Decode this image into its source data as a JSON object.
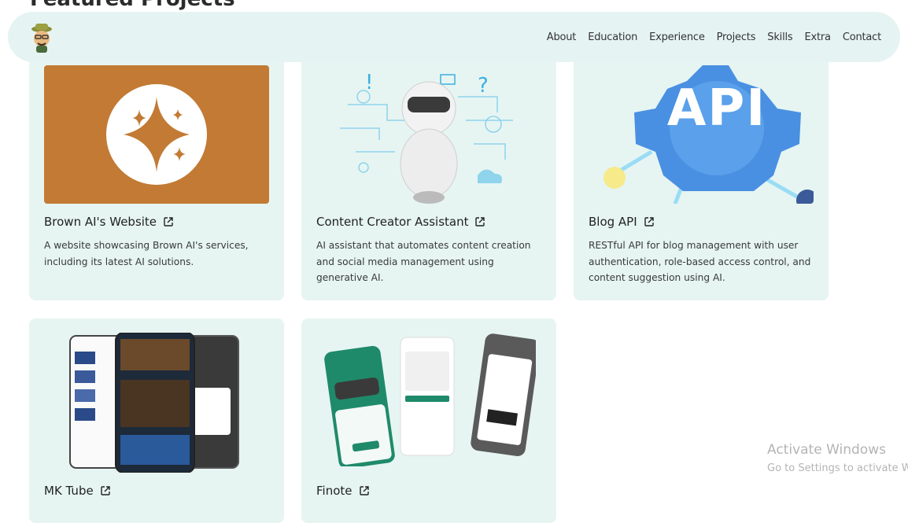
{
  "page": {
    "section_title": "Featured Projects"
  },
  "nav": {
    "items": [
      "About",
      "Education",
      "Experience",
      "Projects",
      "Skills",
      "Extra",
      "Contact"
    ]
  },
  "projects": [
    {
      "title": "Brown AI's Website",
      "description": "A website showcasing Brown AI's services, including its latest AI solutions.",
      "icon": "sparkle-logo-icon"
    },
    {
      "title": "Content Creator Assistant",
      "description": "AI assistant that automates content creation and social media management using generative AI.",
      "icon": "robot-illustration"
    },
    {
      "title": "Blog API",
      "description": "RESTful API for blog management with user authentication, role-based access control, and content suggestion using AI.",
      "icon": "api-gear-illustration",
      "thumb_label": "API"
    },
    {
      "title": "MK Tube",
      "description": "",
      "icon": "phone-screens-illustration"
    },
    {
      "title": "Finote",
      "description": "",
      "icon": "travel-app-screens-illustration"
    }
  ],
  "watermark": {
    "line1": "Activate Windows",
    "line2": "Go to Settings to activate Windows."
  },
  "colors": {
    "nav_bg": "#e5f4f2",
    "card_bg": "#e6f5f2",
    "brown": "#c17a35",
    "api_blue": "#4a90e2"
  }
}
